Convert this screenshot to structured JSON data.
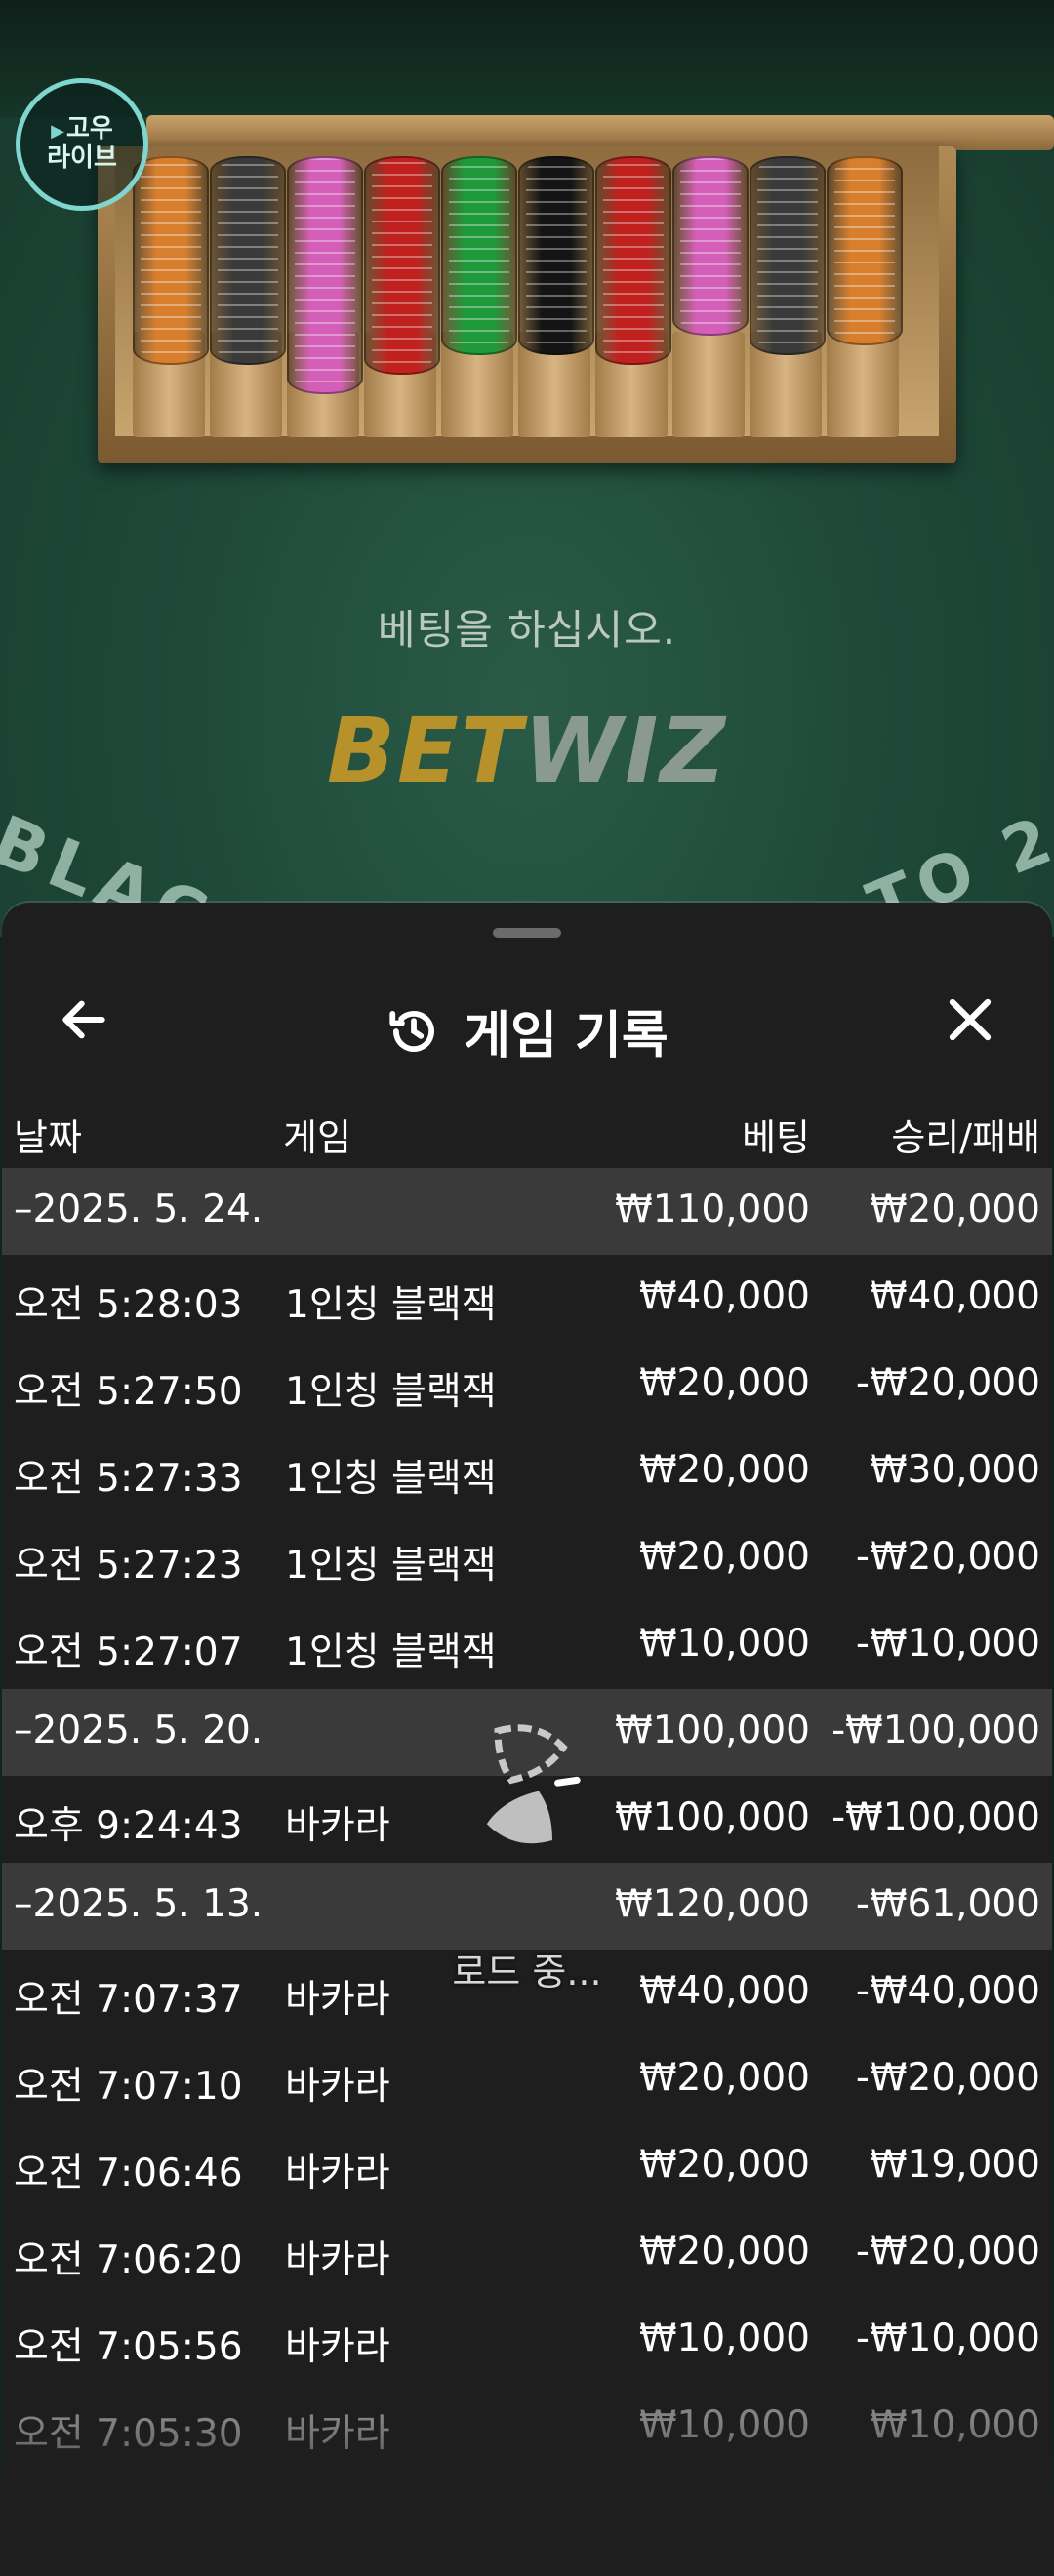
{
  "brand": {
    "line1": "고우",
    "line2": "라이브"
  },
  "game_bg": {
    "prompt": "베팅을 하십시오.",
    "logo_part1": "BET",
    "logo_part2": "WIZ",
    "arc_left": "BLAC",
    "arc_right": "TO 2",
    "chip_colors": [
      "#d87f2e",
      "#3a3a3a",
      "#d45fb8",
      "#c0201e",
      "#1e9a3a",
      "#141414",
      "#c0201e",
      "#d45fb8",
      "#3a3a3a",
      "#d87f2e"
    ]
  },
  "sheet": {
    "title": "게임 기록",
    "icons": {
      "back": "back-arrow-icon",
      "history": "history-icon",
      "close": "close-icon"
    },
    "columns": {
      "date": "날짜",
      "game": "게임",
      "bet": "베팅",
      "result": "승리/패배"
    },
    "rows": [
      {
        "type": "group",
        "date": "–2025. 5. 24.",
        "game": "",
        "bet": "₩110,000",
        "result": "₩20,000"
      },
      {
        "type": "item",
        "date": "오전 5:28:03",
        "game": "1인칭 블랙잭",
        "bet": "₩40,000",
        "result": "₩40,000"
      },
      {
        "type": "item",
        "date": "오전 5:27:50",
        "game": "1인칭 블랙잭",
        "bet": "₩20,000",
        "result": "-₩20,000"
      },
      {
        "type": "item",
        "date": "오전 5:27:33",
        "game": "1인칭 블랙잭",
        "bet": "₩20,000",
        "result": "₩30,000"
      },
      {
        "type": "item",
        "date": "오전 5:27:23",
        "game": "1인칭 블랙잭",
        "bet": "₩20,000",
        "result": "-₩20,000"
      },
      {
        "type": "item",
        "date": "오전 5:27:07",
        "game": "1인칭 블랙잭",
        "bet": "₩10,000",
        "result": "-₩10,000"
      },
      {
        "type": "group",
        "date": "–2025. 5. 20.",
        "game": "",
        "bet": "₩100,000",
        "result": "-₩100,000"
      },
      {
        "type": "item",
        "date": "오후 9:24:43",
        "game": "바카라",
        "bet": "₩100,000",
        "result": "-₩100,000"
      },
      {
        "type": "group",
        "date": "–2025. 5. 13.",
        "game": "",
        "bet": "₩120,000",
        "result": "-₩61,000"
      },
      {
        "type": "item",
        "date": "오전 7:07:37",
        "game": "바카라",
        "bet": "₩40,000",
        "result": "-₩40,000"
      },
      {
        "type": "item",
        "date": "오전 7:07:10",
        "game": "바카라",
        "bet": "₩20,000",
        "result": "-₩20,000"
      },
      {
        "type": "item",
        "date": "오전 7:06:46",
        "game": "바카라",
        "bet": "₩20,000",
        "result": "₩19,000"
      },
      {
        "type": "item",
        "date": "오전 7:06:20",
        "game": "바카라",
        "bet": "₩20,000",
        "result": "-₩20,000"
      },
      {
        "type": "item",
        "date": "오전 7:05:56",
        "game": "바카라",
        "bet": "₩10,000",
        "result": "-₩10,000"
      },
      {
        "type": "item",
        "date": "오전 7:05:30",
        "game": "바카라",
        "bet": "₩10,000",
        "result": "₩10,000"
      }
    ],
    "loading_text": "로드 중..."
  }
}
